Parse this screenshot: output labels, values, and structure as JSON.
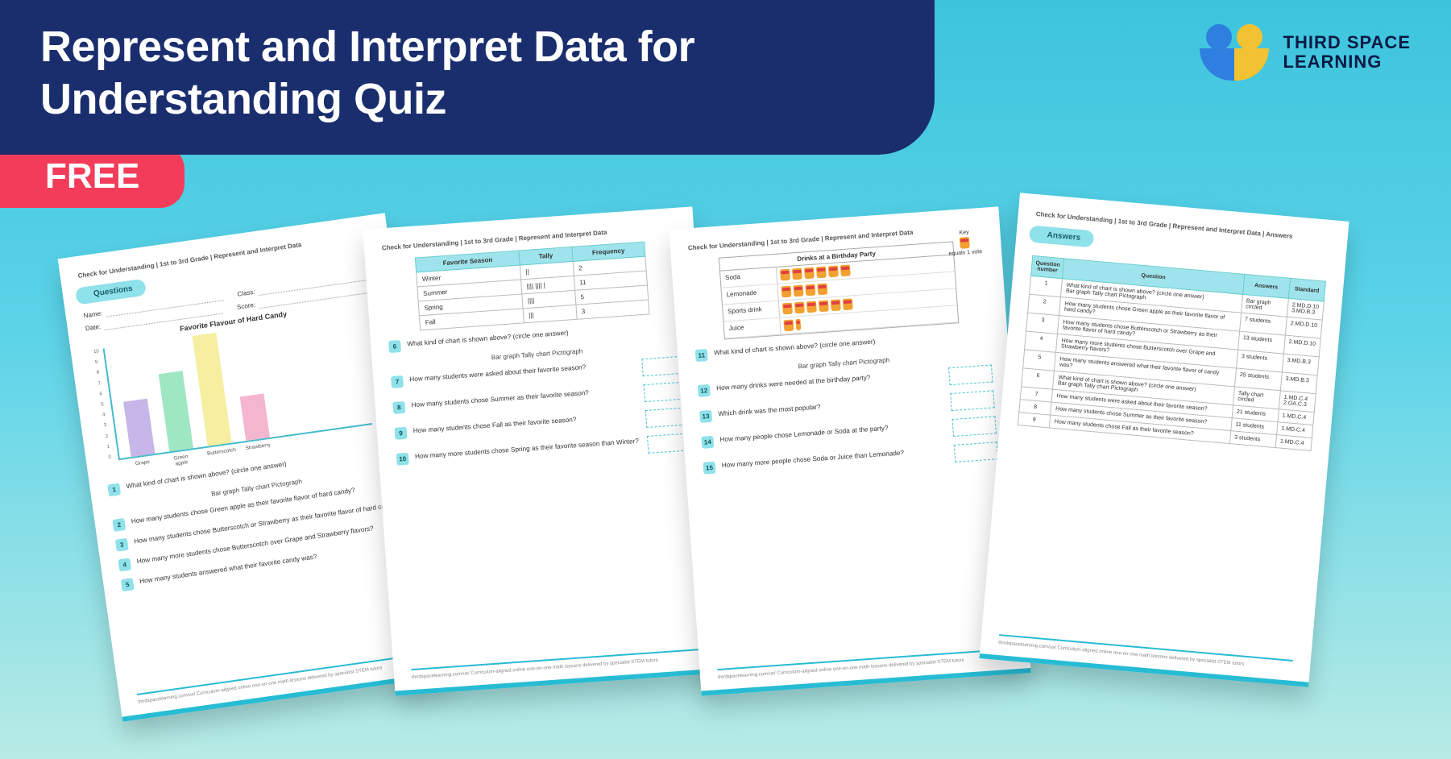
{
  "header": {
    "title": "Represent and Interpret Data for Understanding Quiz"
  },
  "badge": {
    "text": "FREE"
  },
  "brand": {
    "line1": "THIRD SPACE",
    "line2": "LEARNING"
  },
  "sheet1": {
    "crumb": "Check for Understanding | 1st to 3rd Grade | Represent and Interpret Data",
    "pill": "Questions",
    "name_label": "Name:",
    "date_label": "Date:",
    "class_label": "Class:",
    "score_label": "Score:",
    "chart": {
      "title": "Favorite Flavour of Hard Candy",
      "yticks": [
        "0",
        "1",
        "2",
        "3",
        "4",
        "5",
        "6",
        "7",
        "8",
        "9",
        "10"
      ]
    },
    "questions": [
      "What kind of chart is shown above? (circle one answer)",
      "How many students chose Green apple as their favorite flavor of hard candy?",
      "How many students chose Butterscotch or Strawberry as their favorite flavor of hard candy?",
      "How many more students chose Butterscotch over Grape and Strawberry flavors?",
      "How many students answered what their favorite candy was?"
    ],
    "options": "Bar graph    Tally chart    Pictograph",
    "footer": "thirdspacelearning.com/us/    Curriculum-aligned online one-on-one math lessons delivered by specialist STEM tutors"
  },
  "sheet2": {
    "crumb": "Check for Understanding | 1st to 3rd Grade | Represent and Interpret Data",
    "table": {
      "headers": [
        "Favorite Season",
        "Tally",
        "Frequency"
      ],
      "rows": [
        [
          "Winter",
          "||",
          "2"
        ],
        [
          "Summer",
          "|||| |||| |",
          "11"
        ],
        [
          "Spring",
          "||||",
          "5"
        ],
        [
          "Fall",
          "|||",
          "3"
        ]
      ]
    },
    "questions": [
      "What kind of chart is shown above? (circle one answer)",
      "How many students were asked about their favorite season?",
      "How many students chose Summer as their favorite season?",
      "How many students chose Fall as their favorite season?",
      "How many more students chose Spring as their favorite season than Winter?"
    ],
    "options": "Bar graph    Tally chart    Pictograph",
    "qstart": 6,
    "footer": "thirdspacelearning.com/us/    Curriculum-aligned online one-on-one math lessons delivered by specialist STEM tutors"
  },
  "sheet3": {
    "crumb": "Check for Understanding | 1st to 3rd Grade | Represent and Interpret Data",
    "key_label": "Key",
    "key_text": "equals 1 vote",
    "picto": {
      "title": "Drinks at a Birthday Party",
      "rows": [
        {
          "label": "Soda",
          "count": 6
        },
        {
          "label": "Lemonade",
          "count": 4
        },
        {
          "label": "Sports drink",
          "count": 6
        },
        {
          "label": "Juice",
          "count": 1.5
        }
      ]
    },
    "questions": [
      "What kind of chart is shown above? (circle one answer)",
      "How many drinks were needed at the birthday party?",
      "Which drink was the most popular?",
      "How many people chose Lemonade or Soda at the party?",
      "How many more people chose Soda or Juice than Lemonade?"
    ],
    "options": "Bar graph    Tally chart    Pictograph",
    "qstart": 11,
    "footer": "thirdspacelearning.com/us/    Curriculum-aligned online one-on-one math lessons delivered by specialist STEM tutors"
  },
  "sheet4": {
    "crumb": "Check for Understanding | 1st to 3rd Grade | Represent and Interpret Data | Answers",
    "pill": "Answers",
    "headers": [
      "Question number",
      "Question",
      "Answers",
      "Standard"
    ],
    "rows": [
      [
        "1",
        "What kind of chart is shown above? (circle one answer)\nBar graph   Tally chart   Pictograph",
        "Bar graph circled",
        "2.MD.D.10\n3.MD.B.3"
      ],
      [
        "2",
        "How many students chose Green apple as their favorite flavor of hard candy?",
        "7 students",
        "2.MD.D.10"
      ],
      [
        "3",
        "How many students chose Butterscotch or Strawberry as their favorite flavor of hard candy?",
        "13 students",
        "2.MD.D.10"
      ],
      [
        "4",
        "How many more students chose Butterscotch over Grape and Strawberry flavors?",
        "3 students",
        "3.MD.B.3"
      ],
      [
        "5",
        "How many students answered what their favorite flavor of candy was?",
        "25 students",
        "3.MD.B.3"
      ],
      [
        "6",
        "What kind of chart is shown above? (circle one answer)\nBar graph   Tally chart   Pictograph",
        "Tally chart circled",
        "1.MD.C.4\n2.OA.C.3"
      ],
      [
        "7",
        "How many students were asked about their favorite season?",
        "21 students",
        "1.MD.C.4"
      ],
      [
        "8",
        "How many students chose Summer as their favorite season?",
        "11 students",
        "1.MD.C.4"
      ],
      [
        "9",
        "How many students chose Fall as their favorite season?",
        "3 students",
        "1.MD.C.4"
      ]
    ],
    "footer": "thirdspacelearning.com/us/    Curriculum-aligned online one-on-one math lessons delivered by specialist STEM tutors"
  },
  "chart_data": {
    "type": "bar",
    "title": "Favorite Flavour of Hard Candy",
    "categories": [
      "Grape",
      "Green apple",
      "Butterscotch",
      "Strawberry"
    ],
    "values": [
      5,
      7,
      10,
      4
    ],
    "ylim": [
      0,
      10
    ],
    "xlabel": "",
    "ylabel": ""
  },
  "colors": {
    "grape": "#c7b6e8",
    "greenapple": "#9fe6c2",
    "butterscotch": "#f6eea0",
    "strawberry": "#f4b6cf"
  }
}
